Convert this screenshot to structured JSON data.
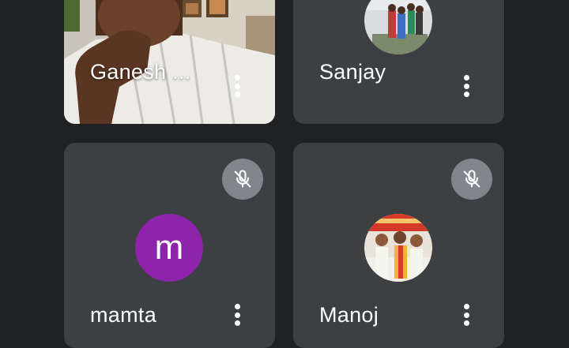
{
  "participants": [
    {
      "name": "Ganesh ...",
      "muted": false,
      "avatar": "camera-video"
    },
    {
      "name": "Sanjay",
      "muted": false,
      "avatar": "photo"
    },
    {
      "name": "mamta",
      "muted": true,
      "avatar": "letter",
      "initial": "m",
      "avatar_color": "#8e24aa"
    },
    {
      "name": "Manoj",
      "muted": true,
      "avatar": "photo"
    }
  ],
  "colors": {
    "background": "#202124",
    "tile": "#3c4043",
    "mute_badge": "#80868b"
  }
}
